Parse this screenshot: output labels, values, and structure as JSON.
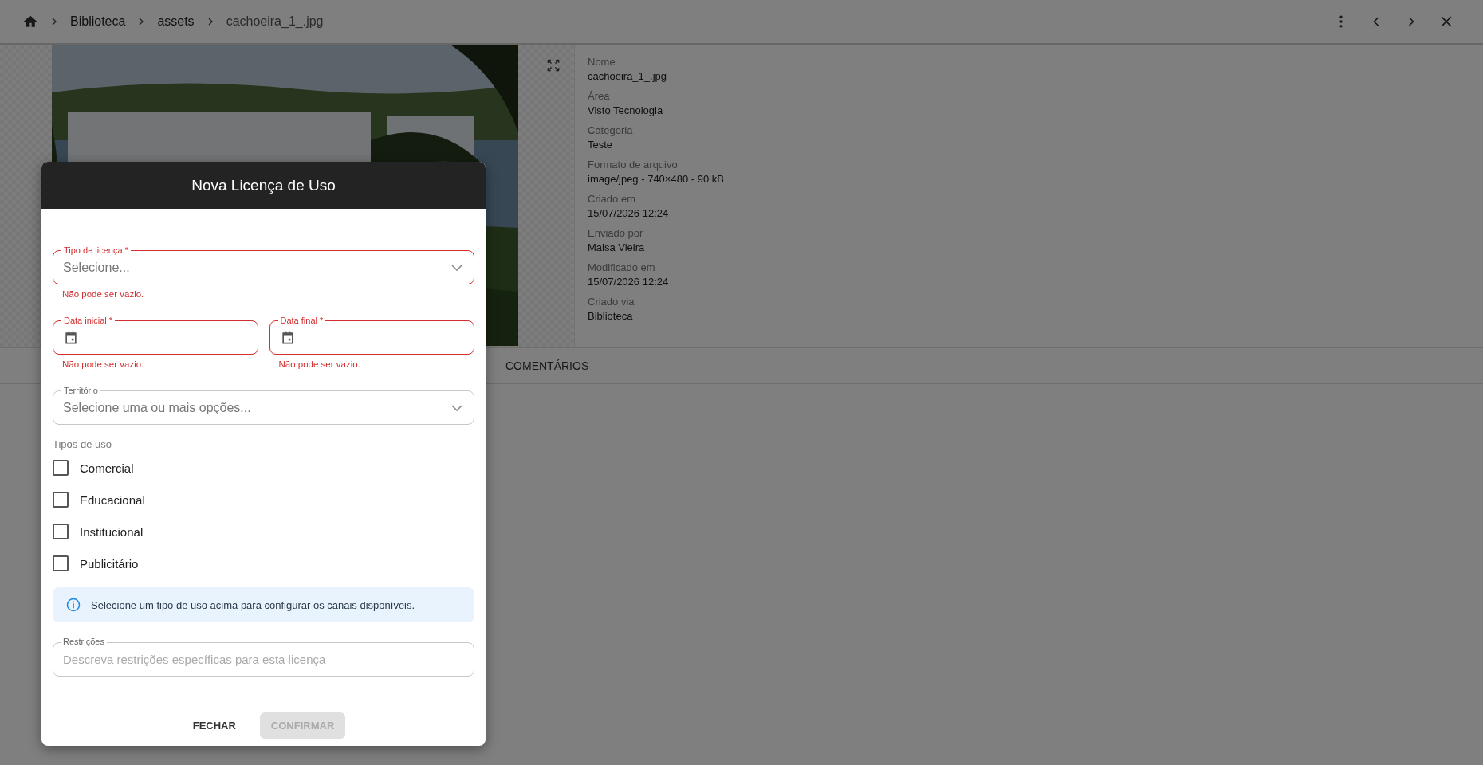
{
  "breadcrumb": {
    "items": [
      "Biblioteca",
      "assets",
      "cachoeira_1_.jpg"
    ]
  },
  "details": [
    {
      "label": "Nome",
      "value": "cachoeira_1_.jpg"
    },
    {
      "label": "Área",
      "value": "Visto Tecnologia"
    },
    {
      "label": "Categoria",
      "value": "Teste"
    },
    {
      "label": "Formato de arquivo",
      "value": "image/jpeg - 740×480 - 90 kB"
    },
    {
      "label": "Criado em",
      "value": "15/07/2026 12:24"
    },
    {
      "label": "Enviado por",
      "value": "Maisa Vieira"
    },
    {
      "label": "Modificado em",
      "value": "15/07/2026 12:24"
    },
    {
      "label": "Criado via",
      "value": "Biblioteca"
    }
  ],
  "tabs": [
    {
      "label": "COMENTÁRIOS",
      "selected": false
    }
  ],
  "dialog": {
    "title": "Nova Licença de Uso",
    "license_type": {
      "label": "Tipo de licença *",
      "placeholder": "Selecione...",
      "invalid": true,
      "error": "Não pode ser vazio."
    },
    "dates": [
      {
        "label": "Data inicial *",
        "invalid": true,
        "error": "Não pode ser vazio."
      },
      {
        "label": "Data final *",
        "invalid": true,
        "error": "Não pode ser vazio."
      }
    ],
    "territory": {
      "label": "Território",
      "placeholder": "Selecione uma ou mais opções...",
      "invalid": false
    },
    "usage_types_label": "Tipos de uso",
    "usage_types": [
      {
        "label": "Comercial",
        "checked": false
      },
      {
        "label": "Educacional",
        "checked": false
      },
      {
        "label": "Institucional",
        "checked": false
      },
      {
        "label": "Publicitário",
        "checked": false
      }
    ],
    "info": "Selecione um tipo de uso acima para configurar os canais disponíveis.",
    "restrictions": {
      "label": "Restrições",
      "placeholder": "Descreva restrições específicas para esta licença"
    },
    "buttons": [
      {
        "label": "FECHAR",
        "kind": "text",
        "disabled": false
      },
      {
        "label": "CONFIRMAR",
        "kind": "filled",
        "disabled": true
      }
    ]
  }
}
